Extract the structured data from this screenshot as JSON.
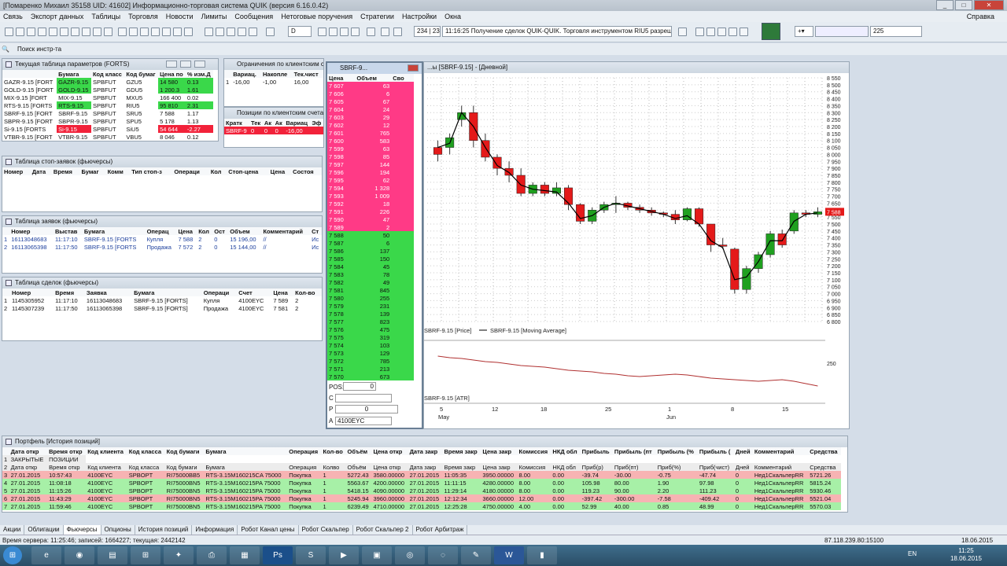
{
  "titlebar": {
    "title": "[Помаренко Михаил 35158 UID: 41602] Информационно-торговая система QUIK (версия 6.16.0.42)"
  },
  "menu": [
    "Связь",
    "Экспорт данных",
    "Таблицы",
    "Торговля",
    "Новости",
    "Лимиты",
    "Сообщения",
    "Нетоговые поручения",
    "Стратегии",
    "Настройки",
    "Окна"
  ],
  "menu_right": "Справка",
  "toolbar": {
    "interval": "D",
    "counter": "234 | 234",
    "message": "11:16:25  Получение сделок QUIK-QUIK. Торговля инструментом RIU5 разреш",
    "zoom_value": "225"
  },
  "search": {
    "placeholder": "Поиск инстр-та"
  },
  "params_window": {
    "title": "Текущая таблица параметров (FORTS)",
    "headers": [
      "Бумага",
      "Код класс",
      "Код бумаг",
      "Цена по",
      "% изм.Д"
    ],
    "rows": [
      {
        "name": "GAZR-9.15 [FORT",
        "sec": "GAZR-9.15",
        "cls": "SPBFUT",
        "code": "GZU5",
        "price": "14 580",
        "pct": "0.13",
        "color": "green"
      },
      {
        "name": "GOLD-9.15 [FORT",
        "sec": "GOLD-9.15",
        "cls": "SPBFUT",
        "code": "GDU5",
        "price": "1 200.3",
        "pct": "1.61",
        "color": "green"
      },
      {
        "name": "MIX-9.15 [FORT",
        "sec": "MIX-9.15",
        "cls": "SPBFUT",
        "code": "MXU5",
        "price": "166 400",
        "pct": "0.02",
        "color": ""
      },
      {
        "name": "RTS-9.15 [FORTS",
        "sec": "RTS-9.15",
        "cls": "SPBFUT",
        "code": "RIU5",
        "price": "95 810",
        "pct": "2.31",
        "color": "green"
      },
      {
        "name": "SBRF-9.15 [FORT",
        "sec": "SBRF-9.15",
        "cls": "SPBFUT",
        "code": "SRU5",
        "price": "7 588",
        "pct": "1.17",
        "color": ""
      },
      {
        "name": "SBPR-9.15 [FORT",
        "sec": "SBPR-9.15",
        "cls": "SPBFUT",
        "code": "SPU5",
        "price": "5 178",
        "pct": "1.13",
        "color": ""
      },
      {
        "name": "Si-9.15 [FORTS",
        "sec": "Si-9.15",
        "cls": "SPBFUT",
        "code": "SiU5",
        "price": "54 644",
        "pct": "-2.27",
        "color": "red"
      },
      {
        "name": "VTBR-9.15 [FORT",
        "sec": "VTBR-9.15",
        "cls": "SPBFUT",
        "code": "VBU5",
        "price": "8 046",
        "pct": "0.12",
        "color": ""
      }
    ]
  },
  "limits_window": {
    "title": "Ограничения по клиентским сч",
    "headers": [
      "Вариац.",
      "Накопле",
      "Тек.чист"
    ],
    "row": [
      "1",
      "-16,00",
      "-1,00",
      "16,00"
    ]
  },
  "positions_window": {
    "title": "Позиции по клиентским счета",
    "headers": [
      "Кратк",
      "Тек",
      "Ак",
      "Ак",
      "Вариац",
      "Эф"
    ],
    "row": [
      "SBRF-9",
      "0",
      "0",
      "0",
      "-16,00",
      ""
    ]
  },
  "orderbook": {
    "title": "SBRF-9...",
    "headers": [
      "Цена",
      "Объем",
      "Сво"
    ],
    "asks": [
      [
        "7 607",
        "63"
      ],
      [
        "7 606",
        "6"
      ],
      [
        "7 605",
        "67"
      ],
      [
        "7 604",
        "24"
      ],
      [
        "7 603",
        "29"
      ],
      [
        "7 602",
        "12"
      ],
      [
        "7 601",
        "765"
      ],
      [
        "7 600",
        "583"
      ],
      [
        "7 599",
        "63"
      ],
      [
        "7 598",
        "85"
      ],
      [
        "7 597",
        "144"
      ],
      [
        "7 596",
        "194"
      ],
      [
        "7 595",
        "62"
      ],
      [
        "7 594",
        "1 328"
      ],
      [
        "7 593",
        "1 009"
      ],
      [
        "7 592",
        "18"
      ],
      [
        "7 591",
        "226"
      ],
      [
        "7 590",
        "47"
      ],
      [
        "7 589",
        "2"
      ]
    ],
    "bids": [
      [
        "7 588",
        "50"
      ],
      [
        "7 587",
        "6"
      ],
      [
        "7 586",
        "137"
      ],
      [
        "7 585",
        "150"
      ],
      [
        "7 584",
        "45"
      ],
      [
        "7 583",
        "78"
      ],
      [
        "7 582",
        "49"
      ],
      [
        "7 581",
        "845"
      ],
      [
        "7 580",
        "255"
      ],
      [
        "7 579",
        "231"
      ],
      [
        "7 578",
        "139"
      ],
      [
        "7 577",
        "823"
      ],
      [
        "7 576",
        "475"
      ],
      [
        "7 575",
        "319"
      ],
      [
        "7 574",
        "103"
      ],
      [
        "7 573",
        "129"
      ],
      [
        "7 572",
        "785"
      ],
      [
        "7 571",
        "213"
      ],
      [
        "7 570",
        "673"
      ]
    ],
    "pos_label": "POS:",
    "pos_value": "0",
    "c_label": "C",
    "p_label": "P",
    "q_value": "0",
    "a_label": "A",
    "account": "4100EYC"
  },
  "stop_orders": {
    "title": "Таблица стоп-заявок (фьючерсы)",
    "headers": [
      "Номер",
      "Дата",
      "Время",
      "Бумаг",
      "Комм",
      "Тип стоп-з",
      "Операци",
      "Кол",
      "Стоп-цена",
      "Цена",
      "Состоя"
    ]
  },
  "orders": {
    "title": "Таблица заявок (фьючерсы)",
    "headers": [
      "Номер",
      "Выстав",
      "Бумага",
      "Операц",
      "Цена",
      "Кол",
      "Ост",
      "Объем",
      "Комментарий",
      "Ст"
    ],
    "rows": [
      [
        "1",
        "16113048683",
        "11:17:10",
        "SBRF-9.15 [FORTS",
        "Купля",
        "7 588",
        "2",
        "0",
        "15 196,00",
        "//",
        "Ис"
      ],
      [
        "2",
        "16113065398",
        "11:17:50",
        "SBRF-9.15 [FORTS",
        "Продажа",
        "7 572",
        "2",
        "0",
        "15 144,00",
        "//",
        "Ис"
      ]
    ]
  },
  "trades": {
    "title": "Таблица сделок (фьючерсы)",
    "headers": [
      "Номер",
      "Время",
      "Заявка",
      "Бумага",
      "Операци",
      "Счет",
      "Цена",
      "Кол-во"
    ],
    "rows": [
      [
        "1",
        "1145305952",
        "11:17:10",
        "16113048683",
        "SBRF-9.15 [FORTS]",
        "Купля",
        "4100EYC",
        "7 589",
        "2"
      ],
      [
        "2",
        "1145307239",
        "11:17:50",
        "16113065398",
        "SBRF-9.15 [FORTS]",
        "Продажа",
        "4100EYC",
        "7 581",
        "2"
      ]
    ]
  },
  "chart": {
    "title": "...ы [SBRF-9.15] - [Дневной]",
    "legend_price": "SBRF-9.15 [Price]",
    "legend_ma": "SBRF-9.15 [Moving Average]",
    "atr_label": "SBRF-9.15 [ATR]",
    "atr_tick": "250",
    "price_ticks": [
      "8 550",
      "8 500",
      "8 450",
      "8 400",
      "8 350",
      "8 300",
      "8 250",
      "8 200",
      "8 150",
      "8 100",
      "8 050",
      "8 000",
      "7 950",
      "7 900",
      "7 850",
      "7 800",
      "7 750",
      "7 700",
      "7 650",
      "7 600",
      "7 550",
      "7 500",
      "7 450",
      "7 400",
      "7 350",
      "7 300",
      "7 250",
      "7 200",
      "7 150",
      "7 100",
      "7 050",
      "7 000",
      "6 950",
      "6 900",
      "6 850",
      "6 800"
    ],
    "current_price": "7 588",
    "x_ticks": [
      "5",
      "12",
      "18",
      "25",
      "1",
      "8",
      "15"
    ],
    "months": [
      "May",
      "Jun"
    ],
    "candle_color_up": "#1fa01f",
    "candle_color_down": "#e41a1a"
  },
  "chart_data": {
    "type": "candlestick",
    "series": [
      {
        "name": "SBRF-9.15 [Price]",
        "ohlc": [
          [
            8050,
            8100,
            7950,
            8000
          ],
          [
            8050,
            8150,
            8000,
            8120
          ],
          [
            8250,
            8350,
            8200,
            8300
          ],
          [
            8300,
            8350,
            8050,
            8100
          ],
          [
            8100,
            8150,
            7950,
            7980
          ],
          [
            7980,
            8000,
            7850,
            7900
          ],
          [
            7900,
            7950,
            7800,
            7850
          ],
          [
            7850,
            7900,
            7700,
            7720
          ],
          [
            7720,
            7800,
            7700,
            7780
          ],
          [
            7780,
            7800,
            7700,
            7720
          ],
          [
            7720,
            7800,
            7700,
            7760
          ],
          [
            7760,
            7780,
            7600,
            7640
          ],
          [
            7640,
            7650,
            7500,
            7520
          ],
          [
            7520,
            7620,
            7500,
            7600
          ],
          [
            7600,
            7660,
            7580,
            7640
          ],
          [
            7640,
            7700,
            7580,
            7650
          ],
          [
            7650,
            7660,
            7600,
            7620
          ],
          [
            7620,
            7640,
            7580,
            7600
          ],
          [
            7600,
            7620,
            7560,
            7580
          ],
          [
            7580,
            7590,
            7550,
            7570
          ],
          [
            7570,
            7600,
            7500,
            7530
          ],
          [
            7530,
            7620,
            7520,
            7610
          ],
          [
            7610,
            7620,
            7480,
            7500
          ],
          [
            7500,
            7500,
            7300,
            7350
          ],
          [
            7350,
            7400,
            7320,
            7340
          ],
          [
            7320,
            7330,
            7000,
            7030
          ],
          [
            7030,
            7200,
            7000,
            7180
          ],
          [
            7180,
            7300,
            7150,
            7280
          ],
          [
            7280,
            7450,
            7260,
            7430
          ],
          [
            7430,
            7460,
            7330,
            7350
          ],
          [
            7450,
            7600,
            7430,
            7580
          ],
          [
            7580,
            7600,
            7550,
            7570
          ],
          [
            7570,
            7620,
            7550,
            7588
          ]
        ]
      },
      {
        "name": "SBRF-9.15 [Moving Average]",
        "values": [
          8050,
          8080,
          8300,
          8200,
          8050,
          7920,
          7870,
          7780,
          7750,
          7740,
          7730,
          7650,
          7540,
          7560,
          7620,
          7650,
          7630,
          7610,
          7590,
          7570,
          7540,
          7560,
          7500,
          7380,
          7330,
          7100,
          7120,
          7230,
          7380,
          7380,
          7520,
          7570,
          7580
        ]
      }
    ],
    "ylim": [
      6800,
      8550
    ]
  },
  "portfolio": {
    "title": "Портфель [История позиций]",
    "headers": [
      "Дата откр",
      "Время откр",
      "Код клиента",
      "Код класса",
      "Код бумаги",
      "Бумага",
      "Операция",
      "Кол-во",
      "Объём",
      "Цена откр",
      "Дата закр",
      "Время закр",
      "Цена закр",
      "Комиссия",
      "НКД обл",
      "Прибыль",
      "Прибыль (пт",
      "Прибыль (%",
      "Прибыль (",
      "Дней",
      "Комментарий",
      "Средства"
    ],
    "row1": [
      "1",
      "ЗАКРЫТЫЕ",
      "ПОЗИЦИИ"
    ],
    "row2": [
      "2",
      "Дата откр",
      "Время откр",
      "Код клиента",
      "Код класса",
      "Код бумаги",
      "Бумага",
      "Операция",
      "Колво",
      "Объём",
      "Цена откр",
      "Дата закр",
      "Время закр",
      "Цена закр",
      "Комиссия",
      "НКД обл",
      "Приб(р)",
      "Приб(пт)",
      "Приб(%)",
      "Приб(чист)",
      "Дней",
      "Комментарий",
      "Средства"
    ],
    "rows": [
      {
        "c": "lr",
        "v": [
          "3",
          "27.01.2015",
          "10:57:43",
          "4100EYC",
          "SPBOPT",
          "RI75000BB5",
          "RTS-3.15M160215CA 75000",
          "Покупка",
          "1",
          "5272.43",
          "3580.00000",
          "27.01.2015",
          "11:05:35",
          "3950.00000",
          "8.00",
          "0.00",
          "-39.74",
          "-30.00",
          "-0.75",
          "-47.74",
          "0",
          "Нед1СкальперRR",
          "5721.26"
        ]
      },
      {
        "c": "lg",
        "v": [
          "4",
          "27.01.2015",
          "11:08:18",
          "4100EYC",
          "SPBOPT",
          "RI75000BN5",
          "RTS-3.15M160215PA 75000",
          "Покупка",
          "1",
          "5563.67",
          "4200.00000",
          "27.01.2015",
          "11:11:15",
          "4280.00000",
          "8.00",
          "0.00",
          "105.98",
          "80.00",
          "1.90",
          "97.98",
          "0",
          "Нед1СкальперRR",
          "5815.24"
        ]
      },
      {
        "c": "lg",
        "v": [
          "5",
          "27.01.2015",
          "11:15:26",
          "4100EYC",
          "SPBOPT",
          "RI75000BN5",
          "RTS-3.15M160215PA 75000",
          "Покупка",
          "1",
          "5418.15",
          "4090.00000",
          "27.01.2015",
          "11:29:14",
          "4180.00000",
          "8.00",
          "0.00",
          "119.23",
          "90.00",
          "2.20",
          "111.23",
          "0",
          "Нед1СкальперRR",
          "5930.46"
        ]
      },
      {
        "c": "lr",
        "v": [
          "6",
          "27.01.2015",
          "11:43:29",
          "4100EYC",
          "SPBOPT",
          "RI75000BN5",
          "RTS-3.15M160215PA 75000",
          "Покупка",
          "1",
          "5245.94",
          "3960.00000",
          "27.01.2015",
          "12:12:34",
          "3660.00000",
          "12.00",
          "0.00",
          "-397.42",
          "-300.00",
          "-7.58",
          "-409.42",
          "0",
          "Нед1СкальперRR",
          "5521.04"
        ]
      },
      {
        "c": "lg",
        "v": [
          "7",
          "27.01.2015",
          "11:59:46",
          "4100EYC",
          "SPBOPT",
          "RI75000BN5",
          "RTS-3.15M160215PA 75000",
          "Покупка",
          "1",
          "6239.49",
          "4710.00000",
          "27.01.2015",
          "12:25:28",
          "4750.00000",
          "4.00",
          "0.00",
          "52.99",
          "40.00",
          "0.85",
          "48.99",
          "0",
          "Нед1СкальперRR",
          "5570.03"
        ]
      }
    ]
  },
  "tabs": [
    "Акции",
    "Облигации",
    "Фьючерсы",
    "Опционы",
    "История позиций",
    "Информация",
    "Робот Канал цены",
    "Робот Скальпер",
    "Робот Скальпер 2",
    "Робот Арбитраж"
  ],
  "active_tab": "Фьючерсы",
  "status": {
    "left": "Время сервера: 11:25:46; записей: 1664227; текущая: 2442142",
    "server": "87.118.239.80:15100",
    "date": "18.06.2015"
  },
  "taskbar": {
    "lang": "EN",
    "time": "11:25",
    "date": "18.06.2015"
  }
}
